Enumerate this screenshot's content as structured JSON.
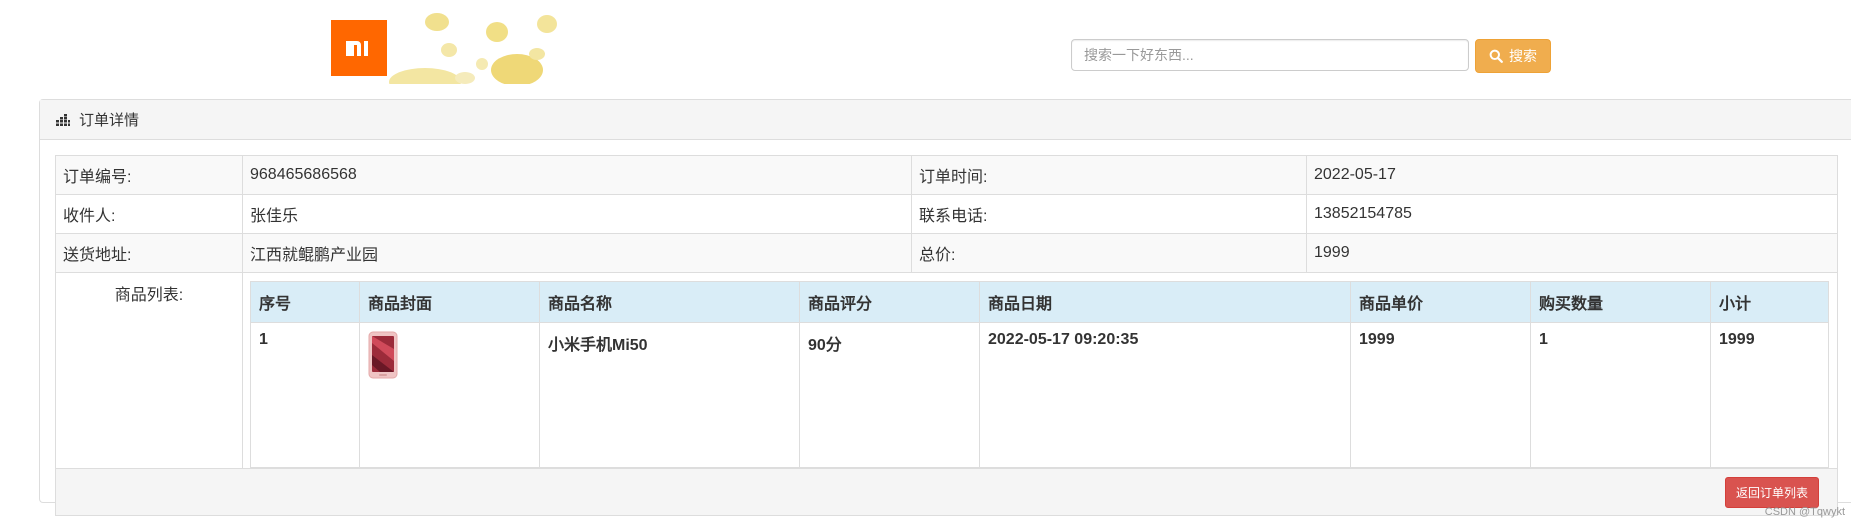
{
  "header": {
    "logo_text": "MI",
    "search_placeholder": "搜索一下好东西...",
    "search_button": "搜索",
    "brand_color": "#ff6700",
    "button_color": "#f0ad4e"
  },
  "panel": {
    "title": "订单详情",
    "title_icon": "bar-chart-icon"
  },
  "order": {
    "id_label": "订单编号:",
    "id_value": "968465686568",
    "time_label": "订单时间:",
    "time_value": "2022-05-17",
    "receiver_label": "收件人:",
    "receiver_value": "张佳乐",
    "phone_label": "联系电话:",
    "phone_value": "13852154785",
    "address_label": "送货地址:",
    "address_value": "江西就鲲鹏产业园",
    "total_label": "总价:",
    "total_value": "1999",
    "list_label": "商品列表:"
  },
  "goods": {
    "headers": [
      "序号",
      "商品封面",
      "商品名称",
      "商品评分",
      "商品日期",
      "商品单价",
      "购买数量",
      "小计"
    ],
    "rows": [
      {
        "index": "1",
        "cover_icon": "phone-image",
        "name": "小米手机Mi50",
        "rating": "90分",
        "date": "2022-05-17 09:20:35",
        "price": "1999",
        "qty": "1",
        "subtotal": "1999"
      }
    ]
  },
  "footer": {
    "back_button": "返回订单列表",
    "watermark": "CSDN @Tqwykt",
    "back_color": "#d9534f"
  }
}
